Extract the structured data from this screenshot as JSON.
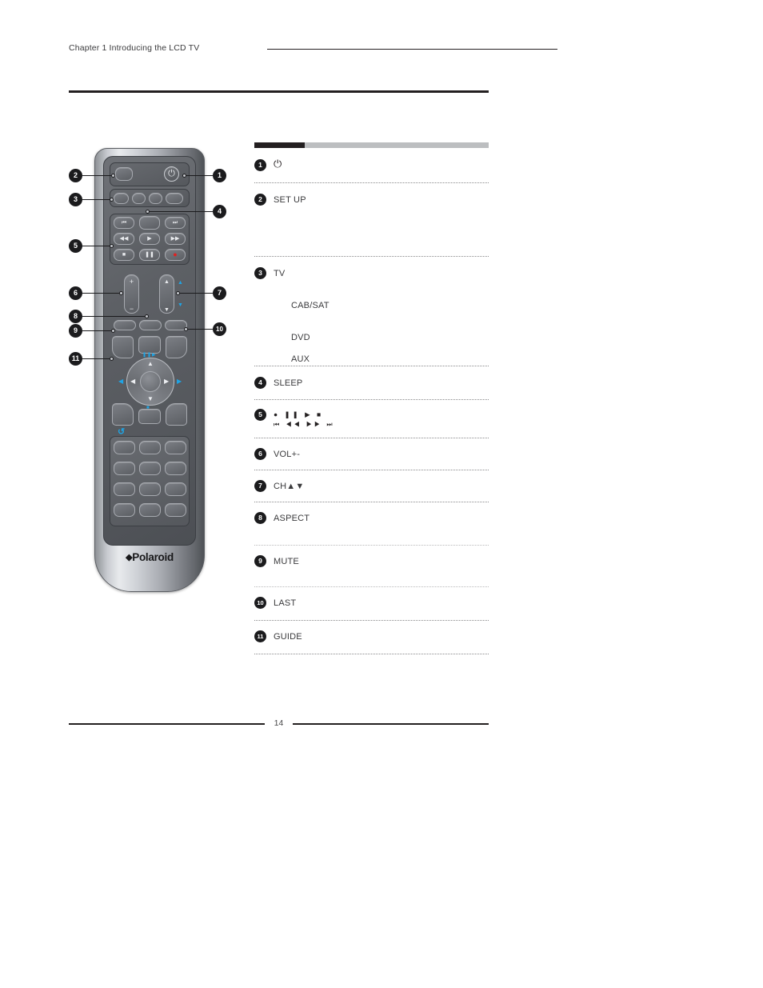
{
  "header": {
    "chapter": "Chapter 1  Introducing the LCD TV"
  },
  "footer": {
    "page_number": "14"
  },
  "illustration": {
    "brand": "Polaroid",
    "brand_diamond": "◆",
    "device": "remote-control",
    "callouts": [
      {
        "number": "1",
        "side": "right"
      },
      {
        "number": "2",
        "side": "left"
      },
      {
        "number": "3",
        "side": "left"
      },
      {
        "number": "4",
        "side": "right"
      },
      {
        "number": "5",
        "side": "left"
      },
      {
        "number": "6",
        "side": "left"
      },
      {
        "number": "7",
        "side": "right"
      },
      {
        "number": "8",
        "side": "left"
      },
      {
        "number": "9",
        "side": "left"
      },
      {
        "number": "10",
        "side": "right"
      },
      {
        "number": "11",
        "side": "left"
      }
    ],
    "button_glyphs": {
      "power": "⏻",
      "skip_back": "⏮",
      "skip_forward": "⏭",
      "rewind": "◀◀",
      "play": "▶",
      "fast_forward": "▶▶",
      "stop": "■",
      "pause": "❚❚",
      "record": "●",
      "volume_up": "+",
      "volume_down": "−",
      "channel_up": "▲",
      "channel_down": "▼",
      "nav_up": "▲",
      "nav_down": "▼",
      "nav_left": "◀",
      "nav_right": "▶",
      "return": "↺"
    }
  },
  "legend": {
    "bar_dark_color": "#231f20",
    "bar_light_color": "#bcbec0",
    "items": [
      {
        "number": "1",
        "label": "",
        "icon": "⏻",
        "type": "icon"
      },
      {
        "number": "2",
        "label": "SET UP",
        "type": "text"
      },
      {
        "number": "3",
        "label": "TV",
        "type": "text",
        "subitems": [
          "CAB/SAT",
          "DVD",
          "AUX"
        ]
      },
      {
        "number": "4",
        "label": "SLEEP",
        "type": "text"
      },
      {
        "number": "5",
        "label": "",
        "type": "glyph-rows",
        "row1": "●  ❚❚  ▶  ■",
        "row2": "⏮  ◀◀  ▶▶  ⏭"
      },
      {
        "number": "6",
        "label": "VOL+-",
        "type": "text"
      },
      {
        "number": "7",
        "label": "CH▲▼",
        "type": "text"
      },
      {
        "number": "8",
        "label": "ASPECT",
        "type": "text"
      },
      {
        "number": "9",
        "label": "MUTE",
        "type": "text"
      },
      {
        "number": "10",
        "label": "LAST",
        "type": "text"
      },
      {
        "number": "11",
        "label": "GUIDE",
        "type": "text"
      }
    ]
  }
}
